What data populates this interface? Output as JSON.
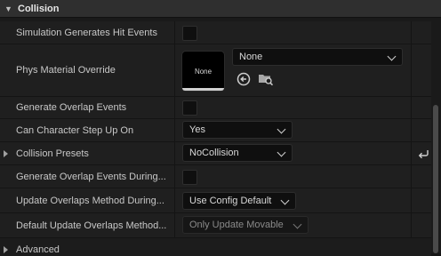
{
  "section": {
    "title": "Collision"
  },
  "rows": {
    "sim_hit": {
      "label": "Simulation Generates Hit Events"
    },
    "phys_material": {
      "label": "Phys Material Override",
      "thumbnail": "None",
      "combo_value": "None"
    },
    "gen_overlap": {
      "label": "Generate Overlap Events"
    },
    "step_up": {
      "label": "Can Character Step Up On",
      "value": "Yes"
    },
    "presets": {
      "label": "Collision Presets",
      "value": "NoCollision"
    },
    "gen_overlap_during": {
      "label": "Generate Overlap Events During..."
    },
    "update_method": {
      "label": "Update Overlaps Method During...",
      "value": "Use Config Default"
    },
    "default_update": {
      "label": "Default Update Overlaps Method...",
      "value": "Only Update Movable"
    },
    "advanced": {
      "label": "Advanced"
    }
  },
  "icons": {
    "section_chevron": "chevron-down-icon",
    "use_selected": "arrow-left-circle-icon",
    "browse": "folder-search-icon",
    "reset": "reset-arrow-icon"
  }
}
